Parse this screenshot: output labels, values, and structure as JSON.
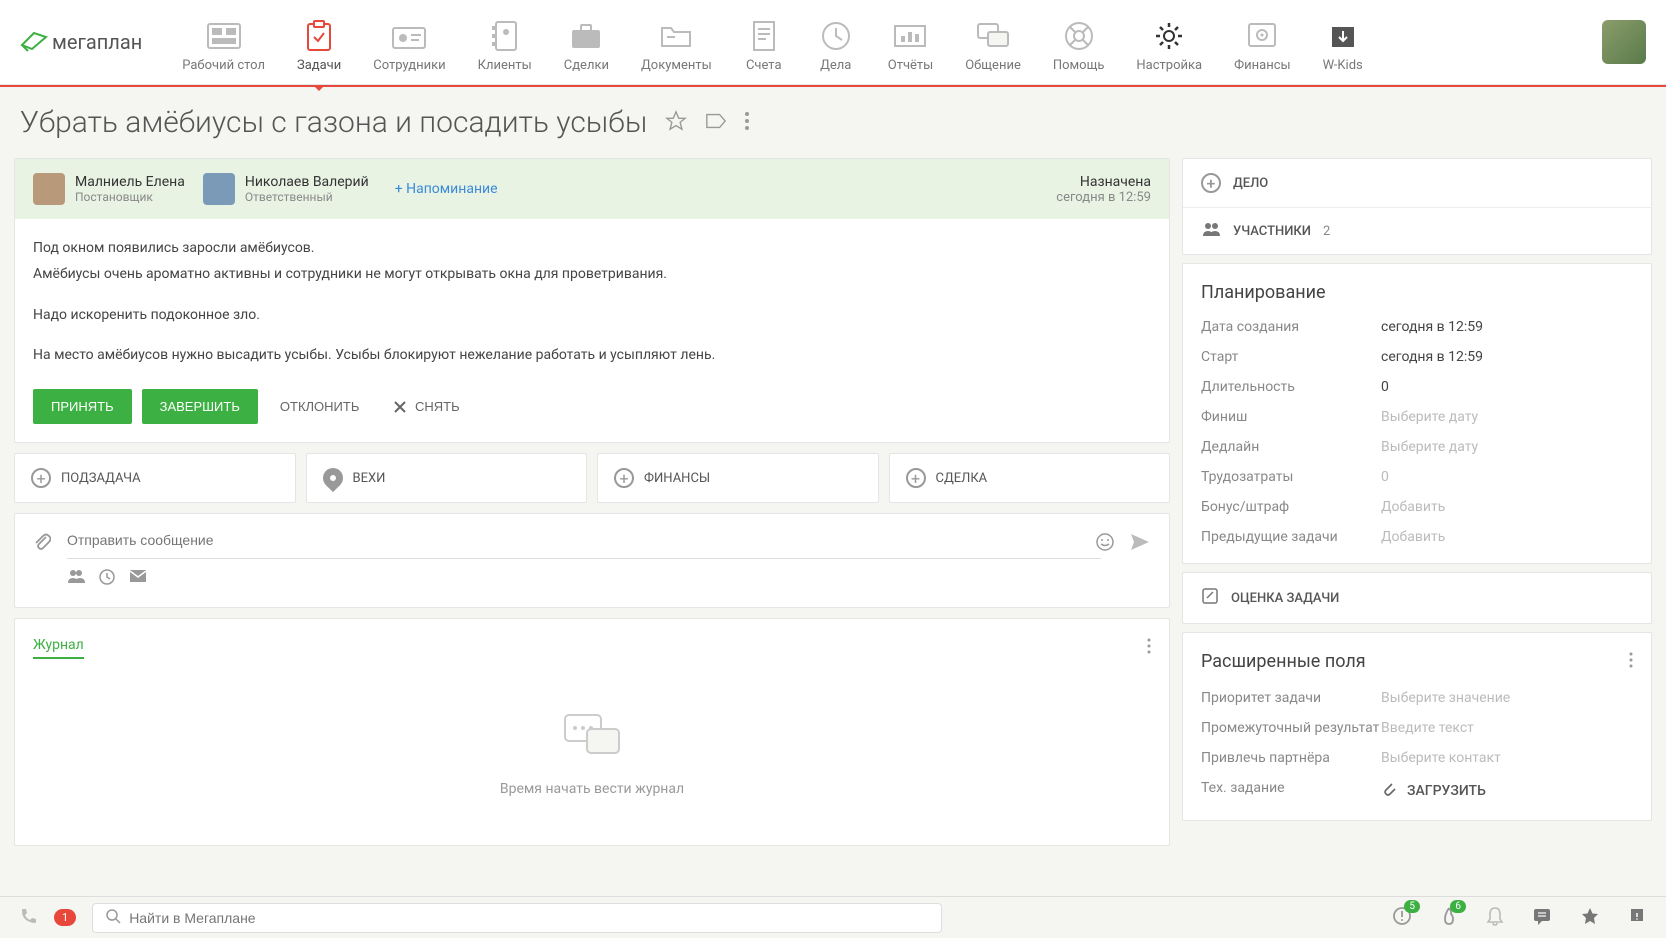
{
  "logo": "мегаплан",
  "nav": [
    {
      "label": "Рабочий стол"
    },
    {
      "label": "Задачи"
    },
    {
      "label": "Сотрудники"
    },
    {
      "label": "Клиенты"
    },
    {
      "label": "Сделки"
    },
    {
      "label": "Документы"
    },
    {
      "label": "Счета"
    },
    {
      "label": "Дела"
    },
    {
      "label": "Отчёты"
    },
    {
      "label": "Общение"
    },
    {
      "label": "Помощь"
    },
    {
      "label": "Настройка"
    },
    {
      "label": "Финансы"
    },
    {
      "label": "W-Kids"
    }
  ],
  "title": "Убрать амёбиусы с газона и посадить усыбы",
  "people": {
    "p1": {
      "name": "Малниель Елена",
      "role": "Постановщик"
    },
    "p2": {
      "name": "Николаев Валерий",
      "role": "Ответственный"
    }
  },
  "reminder": "+ Напоминание",
  "status": {
    "label": "Назначена",
    "time": "сегодня в 12:59"
  },
  "body": {
    "l1": "Под окном появились заросли амёбиусов.",
    "l2": "Амёбиусы очень ароматно активны и сотрудники не могут открывать окна для проветривания.",
    "l3": "Надо искоренить подоконное зло.",
    "l4": "На место амёбиусов нужно высадить усыбы. Усыбы блокируют нежелание работать и усыпляют лень."
  },
  "actions": {
    "accept": "ПРИНЯТЬ",
    "complete": "ЗАВЕРШИТЬ",
    "decline": "ОТКЛОНИТЬ",
    "remove": "СНЯТЬ"
  },
  "tabs": {
    "subtask": "ПОДЗАДАЧА",
    "milestones": "ВЕХИ",
    "finance": "ФИНАНСЫ",
    "deal": "СДЕЛКА"
  },
  "message": {
    "placeholder": "Отправить сообщение"
  },
  "journal": {
    "tab": "Журнал",
    "empty": "Время начать вести журнал"
  },
  "side": {
    "deal": "ДЕЛО",
    "participants": "УЧАСТНИКИ",
    "participants_count": "2",
    "planning": "Планирование",
    "fields": {
      "created_l": "Дата создания",
      "created_v": "сегодня в 12:59",
      "start_l": "Старт",
      "start_v": "сегодня в 12:59",
      "duration_l": "Длительность",
      "duration_v": "0",
      "finish_l": "Финиш",
      "finish_p": "Выберите дату",
      "deadline_l": "Дедлайн",
      "deadline_p": "Выберите дату",
      "labor_l": "Трудозатраты",
      "labor_v": "0",
      "bonus_l": "Бонус/штраф",
      "bonus_p": "Добавить",
      "prev_l": "Предыдущие задачи",
      "prev_p": "Добавить"
    },
    "rating": "ОЦЕНКА ЗАДАЧИ",
    "ext_title": "Расширенные поля",
    "ext": {
      "priority_l": "Приоритет задачи",
      "priority_p": "Выберите значение",
      "interim_l": "Промежуточный результат",
      "interim_p": "Введите текст",
      "partner_l": "Привлечь партнёра",
      "partner_p": "Выберите контакт",
      "tech_l": "Тех. задание",
      "tech_btn": "ЗАГРУЗИТЬ"
    }
  },
  "footer": {
    "search_placeholder": "Найти в Мегаплане",
    "call_count": "1",
    "notif1": "5",
    "notif2": "6"
  }
}
